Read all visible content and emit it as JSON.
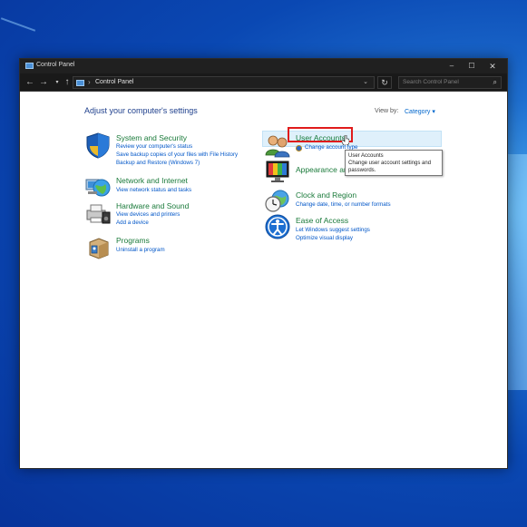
{
  "window": {
    "title": "Control Panel",
    "controls": {
      "minimize": "–",
      "maximize": "☐",
      "close": "✕"
    }
  },
  "addressbar": {
    "back": "←",
    "forward": "→",
    "recent": "▾",
    "up": "↑",
    "separator": "›",
    "path": "Control Panel",
    "dropdown": "⌄",
    "refresh": "↻",
    "search_placeholder": "Search Control Panel",
    "search_icon": "⌕"
  },
  "main": {
    "heading": "Adjust your computer's settings",
    "view_by_label": "View by:",
    "view_by_value": "Category ▾"
  },
  "categories_left": [
    {
      "title": "System and Security",
      "icon": "shield-icon",
      "links": [
        "Review your computer's status",
        "Save backup copies of your files with File History",
        "Backup and Restore (Windows 7)"
      ]
    },
    {
      "title": "Network and Internet",
      "icon": "network-globe-icon",
      "links": [
        "View network status and tasks"
      ]
    },
    {
      "title": "Hardware and Sound",
      "icon": "printer-speaker-icon",
      "links": [
        "View devices and printers",
        "Add a device"
      ]
    },
    {
      "title": "Programs",
      "icon": "programs-box-icon",
      "links": [
        "Uninstall a program"
      ]
    }
  ],
  "categories_right": [
    {
      "title": "User Accounts",
      "icon": "users-icon",
      "links": [
        "Change account type"
      ]
    },
    {
      "title": "Appearance and Personalization",
      "title_visible": "Appearance an",
      "icon": "monitor-paint-icon",
      "links": []
    },
    {
      "title": "Clock and Region",
      "icon": "clock-globe-icon",
      "links": [
        "Change date, time, or number formats"
      ]
    },
    {
      "title": "Ease of Access",
      "icon": "ease-of-access-icon",
      "links": [
        "Let Windows suggest settings",
        "Optimize visual display"
      ]
    }
  ],
  "tooltip": {
    "title": "User Accounts",
    "body": "Change user account settings and passwords."
  },
  "colors": {
    "category_green": "#1a7a3a",
    "link_blue": "#0056c8",
    "highlight_red": "#e01b1b",
    "desktop_blue": "#0a48b3"
  }
}
